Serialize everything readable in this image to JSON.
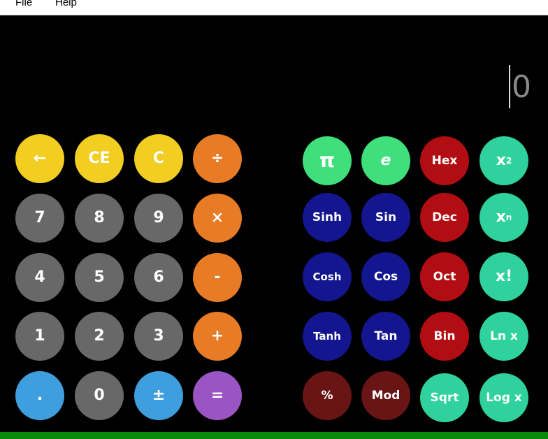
{
  "menu": {
    "file": "File",
    "help": "Help"
  },
  "display": {
    "value": "0"
  },
  "keypad": {
    "backspace": "←",
    "ce": "CE",
    "c": "C",
    "divide": "÷",
    "n7": "7",
    "n8": "8",
    "n9": "9",
    "multiply": "×",
    "n4": "4",
    "n5": "5",
    "n6": "6",
    "minus": "-",
    "n1": "1",
    "n2": "2",
    "n3": "3",
    "plus": "+",
    "dot": ".",
    "n0": "0",
    "plus_minus": "±",
    "equals": "="
  },
  "scientific": {
    "pi": "π",
    "e": "e",
    "hex": "Hex",
    "x_base": "x",
    "x2_exp": "2",
    "sinh": "Sinh",
    "sin": "Sin",
    "dec": "Dec",
    "xn_base": "x",
    "xn_exp": "n",
    "cosh": "Cosh",
    "cos": "Cos",
    "oct": "Oct",
    "factorial": "x!",
    "tanh": "Tanh",
    "tan": "Tan",
    "bin": "Bin",
    "ln": "Ln x",
    "percent": "%",
    "mod": "Mod",
    "sqrt": "Sqrt",
    "log": "Log x"
  },
  "colors": {
    "yellow": "#f2ce23",
    "grey": "#686868",
    "orange": "#e87b26",
    "blue": "#3f9fde",
    "purple": "#9b54c3",
    "light_green": "#3fdf7c",
    "teal": "#2fd29c",
    "navy": "#13168e",
    "red": "#b20d12",
    "maroon": "#6a1515",
    "status_bar": "#0a8a0a"
  }
}
